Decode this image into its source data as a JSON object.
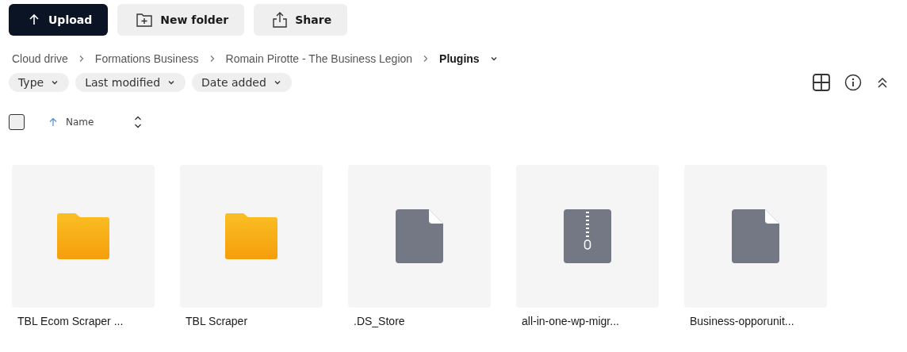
{
  "toolbar": [
    {
      "label": "Upload",
      "kind": "primary"
    },
    {
      "label": "New folder",
      "kind": "folder"
    },
    {
      "label": "Share",
      "kind": "share"
    }
  ],
  "breadcrumb": [
    {
      "label": "Cloud drive",
      "current": false
    },
    {
      "label": "Formations Business",
      "current": false
    },
    {
      "label": "Romain Pirotte - The Business Legion",
      "current": false
    },
    {
      "label": "Plugins",
      "current": true
    }
  ],
  "filters": [
    {
      "label": "Type"
    },
    {
      "label": "Last modified"
    },
    {
      "label": "Date added"
    }
  ],
  "list_header": {
    "checked": false,
    "sort_label": "Name"
  },
  "items": [
    {
      "name": "TBL Ecom Scraper ...",
      "kind": "folder"
    },
    {
      "name": "TBL Scraper",
      "kind": "folder"
    },
    {
      "name": ".DS_Store",
      "kind": "file"
    },
    {
      "name": "all-in-one-wp-migr...",
      "kind": "zip"
    },
    {
      "name": "Business-opporunit...",
      "kind": "file"
    }
  ]
}
